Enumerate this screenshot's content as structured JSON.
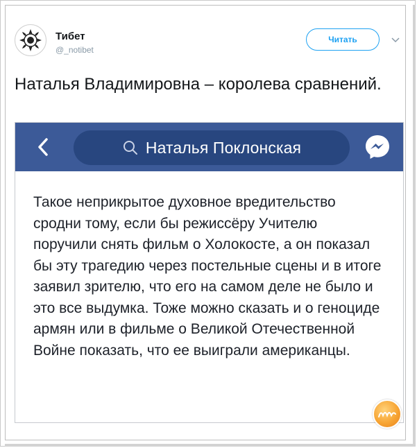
{
  "tweet": {
    "author_name": "Тибет",
    "author_handle": "@_notibet",
    "follow_label": "Читать",
    "text": "Наталья Владимировна – королева сравнений."
  },
  "embedded_screenshot": {
    "search_query": "Наталья Поклонская",
    "post_text": "Такое неприкрытое духовное вредительство сродни тому, если бы режиссёру Учителю поручили снять фильм о Холокосте, а он показал бы эту трагедию через постельные сцены и в итоге заявил зрителю, что его на самом деле не было и это все выдумка. Тоже можно сказать и о геноциде армян или в фильме о Великой Отечественной Войне показать, что ее выиграли американцы."
  },
  "icons": {
    "avatar": "ornament-avatar-icon",
    "caret": "chevron-down-icon",
    "back": "back-arrow-icon",
    "search": "search-icon",
    "messenger": "messenger-icon",
    "watermark": "watermark-logo"
  },
  "colors": {
    "accent": "#1da1f2",
    "facebook_bar": "#3c5a98",
    "search_field": "#28467f",
    "text": "#14171a"
  }
}
